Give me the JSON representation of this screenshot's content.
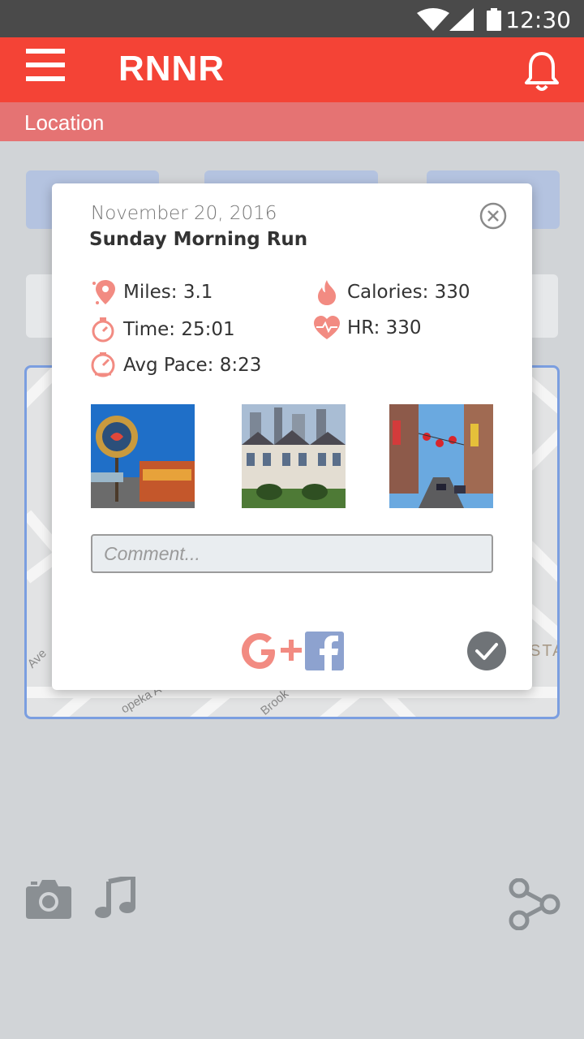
{
  "status_bar": {
    "time": "12:30"
  },
  "app_bar": {
    "title": "RNNR"
  },
  "location_bar": {
    "label": "Location"
  },
  "map": {
    "streets": [
      "Ave",
      "opeka A",
      "Brook",
      "STA"
    ]
  },
  "run": {
    "date": "November 20, 2016",
    "title": "Sunday Morning Run",
    "stats": {
      "miles": "Miles: 3.1",
      "time": "Time: 25:01",
      "pace": "Avg Pace: 8:23",
      "calories": "Calories: 330",
      "hr": "HR: 330"
    },
    "comment_placeholder": "Comment..."
  },
  "colors": {
    "primary": "#f44336",
    "accent_icon": "#f28b82",
    "modal_bg": "#ffffff",
    "map_border": "#7b9ee0",
    "facebook": "#8da2cf"
  },
  "icons": [
    "menu-icon",
    "bell-icon",
    "pin-icon",
    "stopwatch-icon",
    "gauge-icon",
    "flame-icon",
    "heart-rate-icon",
    "close-circle-icon",
    "google-plus-icon",
    "facebook-icon",
    "check-circle-icon",
    "camera-icon",
    "music-icon",
    "share-icon"
  ]
}
